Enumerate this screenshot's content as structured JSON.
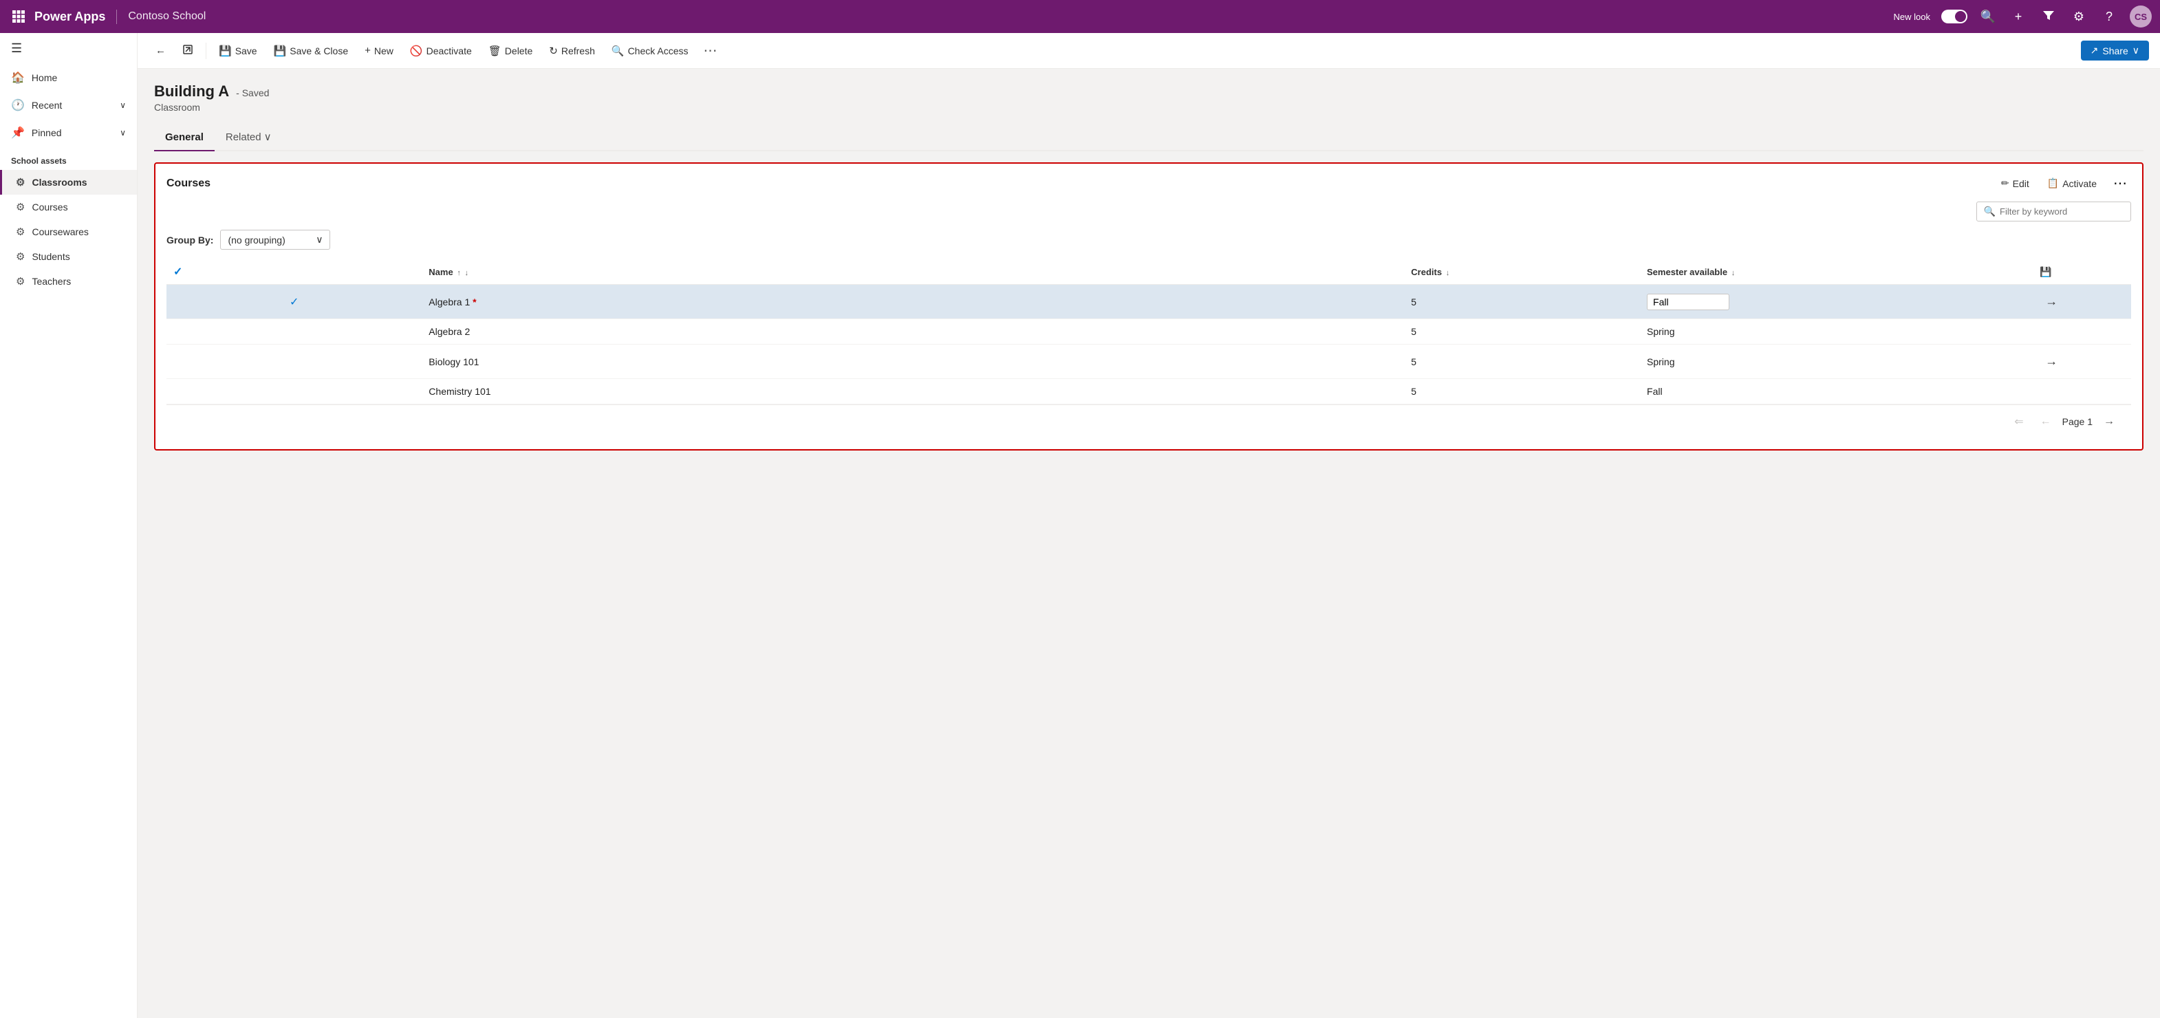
{
  "topnav": {
    "waffle_label": "⊞",
    "brand": "Power Apps",
    "app_name": "Contoso School",
    "new_look_label": "New look",
    "search_icon": "🔍",
    "plus_icon": "+",
    "filter_icon": "⧖",
    "settings_icon": "⚙",
    "help_icon": "?",
    "avatar_label": "CS"
  },
  "sidebar": {
    "hamburger": "☰",
    "nav_items": [
      {
        "id": "home",
        "icon": "🏠",
        "label": "Home"
      },
      {
        "id": "recent",
        "icon": "🕐",
        "label": "Recent",
        "has_chevron": true
      },
      {
        "id": "pinned",
        "icon": "📌",
        "label": "Pinned",
        "has_chevron": true
      }
    ],
    "section_label": "School assets",
    "child_items": [
      {
        "id": "classrooms",
        "icon": "⚙",
        "label": "Classrooms",
        "active": true
      },
      {
        "id": "courses",
        "icon": "⚙",
        "label": "Courses",
        "active": false
      },
      {
        "id": "coursewares",
        "icon": "⚙",
        "label": "Coursewares",
        "active": false
      },
      {
        "id": "students",
        "icon": "⚙",
        "label": "Students",
        "active": false
      },
      {
        "id": "teachers",
        "icon": "⚙",
        "label": "Teachers",
        "active": false
      }
    ]
  },
  "toolbar": {
    "back_icon": "←",
    "open_icon": "⬡",
    "save_label": "Save",
    "save_icon": "💾",
    "save_close_label": "Save & Close",
    "save_close_icon": "💾",
    "new_label": "New",
    "new_icon": "+",
    "deactivate_label": "Deactivate",
    "deactivate_icon": "🚫",
    "delete_label": "Delete",
    "delete_icon": "🗑",
    "refresh_label": "Refresh",
    "refresh_icon": "↻",
    "check_access_label": "Check Access",
    "check_access_icon": "🔍",
    "more_icon": "⋯",
    "share_label": "Share",
    "share_icon": "↗"
  },
  "record": {
    "name": "Building A",
    "saved_label": "- Saved",
    "subtitle": "Classroom",
    "tabs": [
      {
        "id": "general",
        "label": "General",
        "active": true
      },
      {
        "id": "related",
        "label": "Related",
        "active": false,
        "has_chevron": true
      }
    ]
  },
  "courses_section": {
    "title": "Courses",
    "edit_label": "Edit",
    "edit_icon": "✏",
    "activate_label": "Activate",
    "activate_icon": "📋",
    "more_icon": "⋯",
    "filter_placeholder": "Filter by keyword",
    "group_by_label": "Group By:",
    "group_by_value": "(no grouping)",
    "columns": [
      {
        "id": "name",
        "label": "Name",
        "sort": "↑"
      },
      {
        "id": "credits",
        "label": "Credits"
      },
      {
        "id": "semester",
        "label": "Semester available"
      }
    ],
    "rows": [
      {
        "id": 1,
        "name": "Algebra 1",
        "credits": 5,
        "semester": "Fall",
        "selected": true,
        "has_star": true,
        "has_arrow": true
      },
      {
        "id": 2,
        "name": "Algebra 2",
        "credits": 5,
        "semester": "Spring",
        "selected": false,
        "has_star": false,
        "has_arrow": false
      },
      {
        "id": 3,
        "name": "Biology 101",
        "credits": 5,
        "semester": "Spring",
        "selected": false,
        "has_star": false,
        "has_arrow": true
      },
      {
        "id": 4,
        "name": "Chemistry 101",
        "credits": 5,
        "semester": "Fall",
        "selected": false,
        "has_star": false,
        "has_arrow": false
      }
    ],
    "pagination": {
      "page_label": "Page 1",
      "prev_disabled": true,
      "next_disabled": false
    }
  }
}
